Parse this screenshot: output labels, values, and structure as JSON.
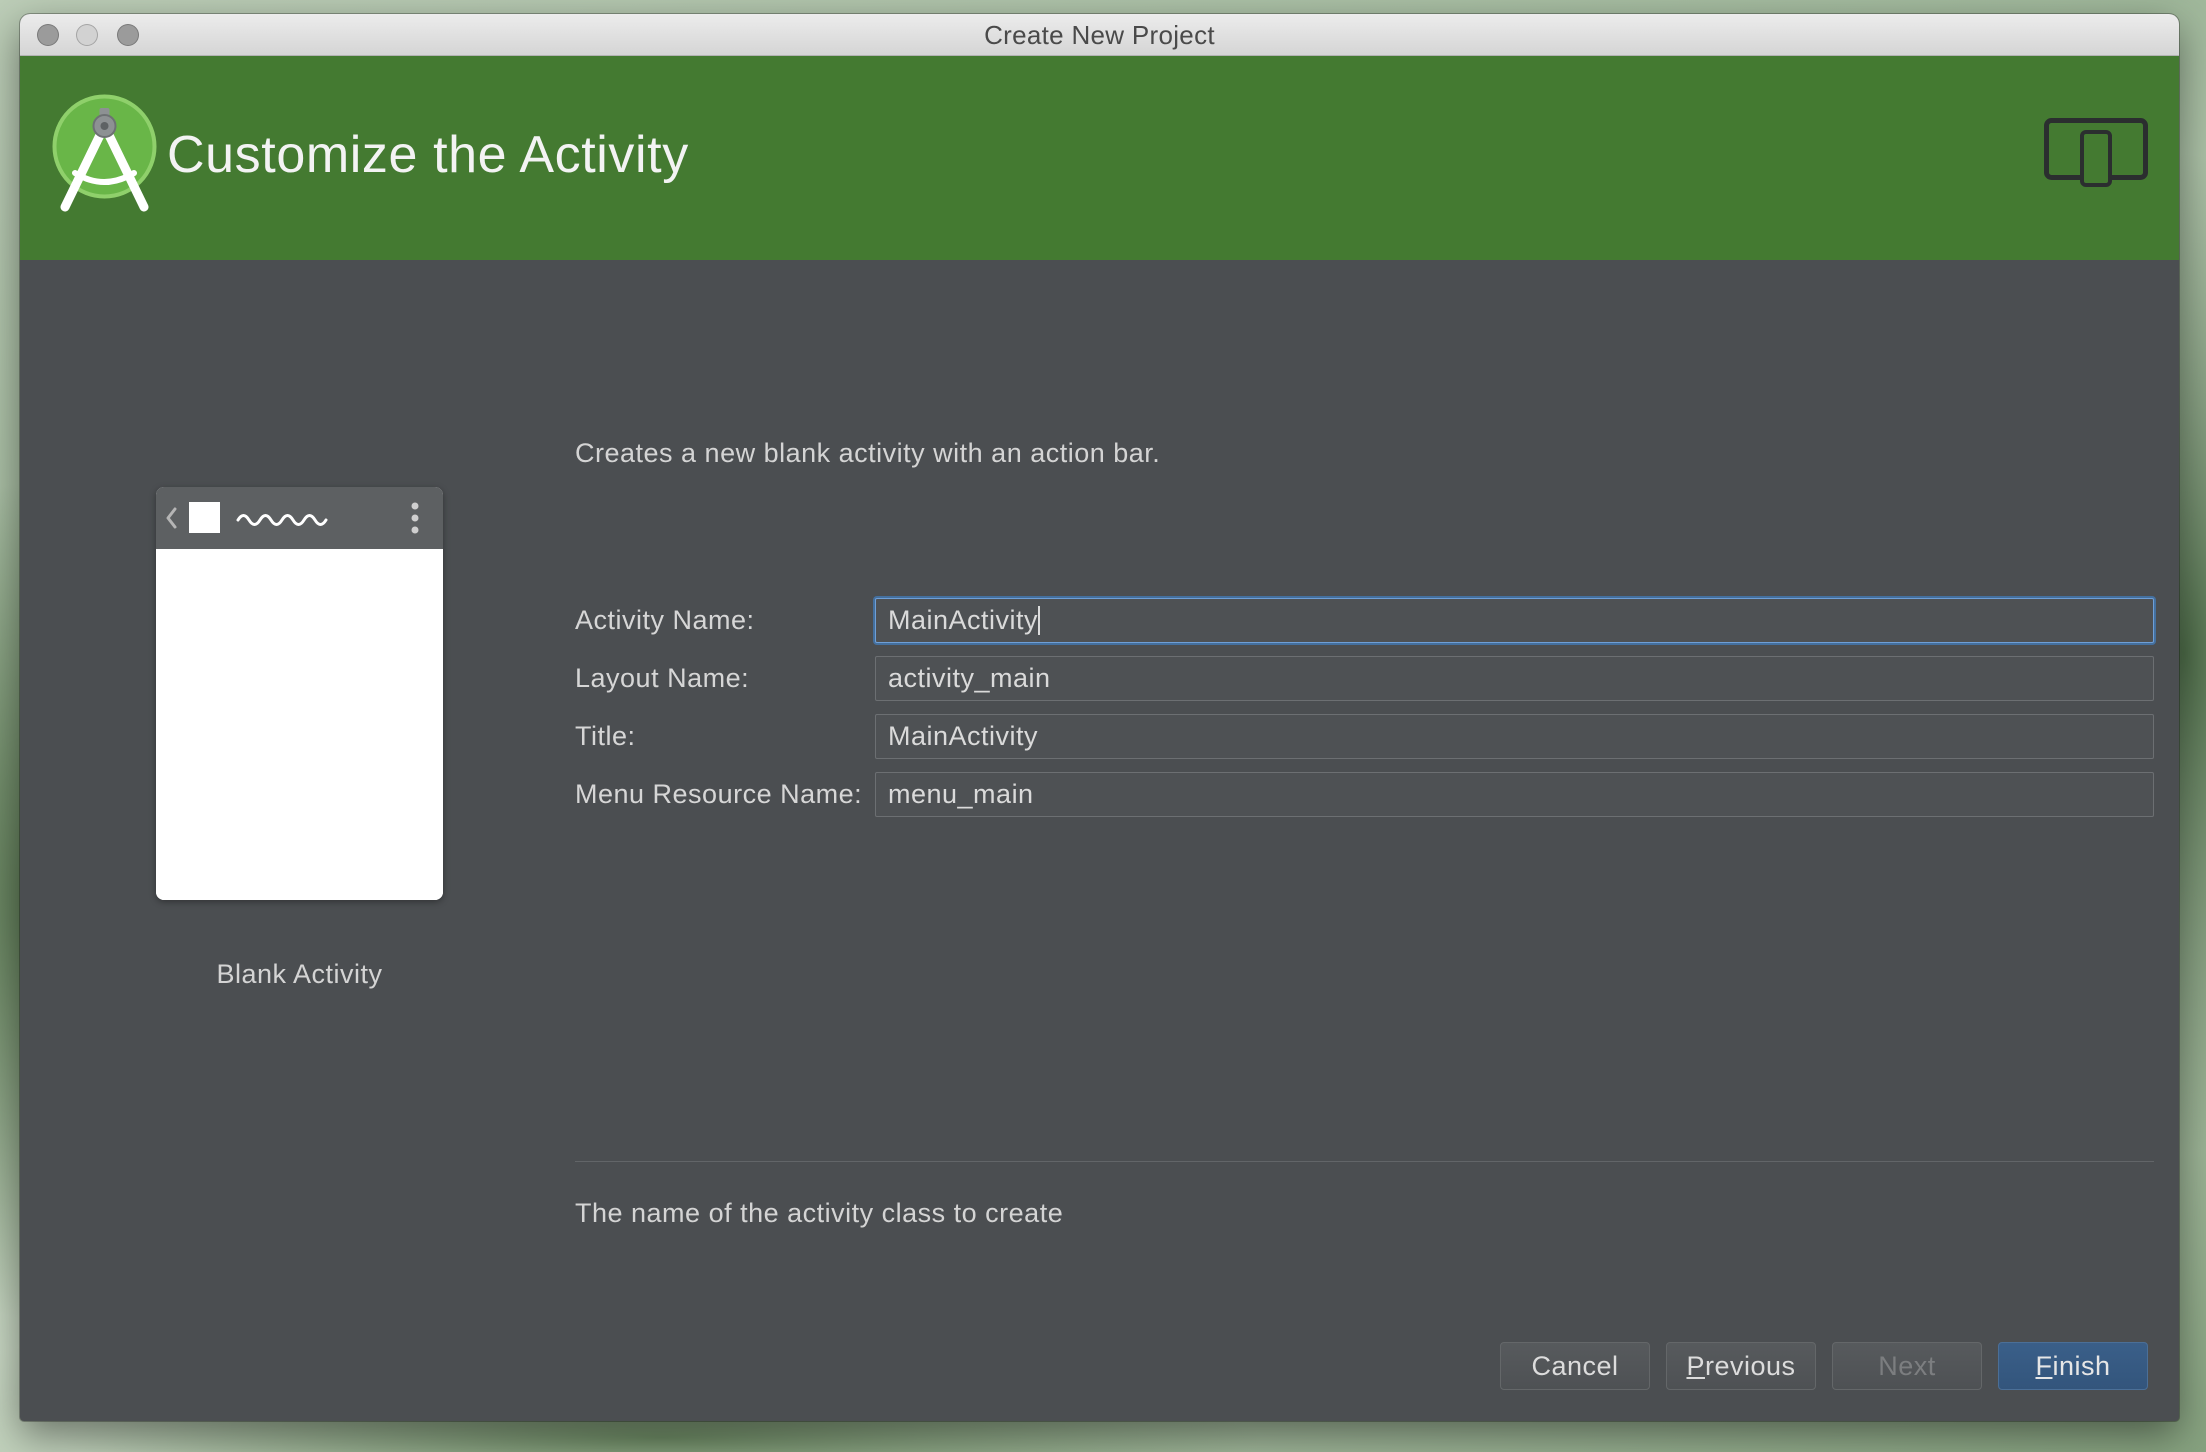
{
  "window": {
    "title": "Create New Project"
  },
  "header": {
    "title": "Customize the Activity",
    "logo_icon": "android-studio-logo-icon",
    "form_factor_icon": "device-form-factor-icon"
  },
  "template": {
    "label": "Blank Activity",
    "toolbar_icons": [
      "back-chevron-icon",
      "app-icon",
      "title-squiggle-icon",
      "overflow-menu-icon"
    ]
  },
  "description": "Creates a new blank activity with an action bar.",
  "form": {
    "fields": [
      {
        "label": "Activity Name:",
        "value": "MainActivity",
        "focused": true
      },
      {
        "label": "Layout Name:",
        "value": "activity_main",
        "focused": false
      },
      {
        "label": "Title:",
        "value": "MainActivity",
        "focused": false
      },
      {
        "label": "Menu Resource Name:",
        "value": "menu_main",
        "focused": false
      }
    ]
  },
  "hint": "The name of the activity class to create",
  "buttons": {
    "cancel": {
      "label": "Cancel",
      "enabled": true,
      "default": false,
      "mnemonic": false
    },
    "previous": {
      "label": "Previous",
      "enabled": true,
      "default": false,
      "mnemonic": true
    },
    "next": {
      "label": "Next",
      "enabled": false,
      "default": false,
      "mnemonic": false
    },
    "finish": {
      "label": "Finish",
      "enabled": true,
      "default": true,
      "mnemonic": true
    }
  },
  "colors": {
    "header": "#447a31",
    "panel": "#4b4e51",
    "default_button": "#365880",
    "focus_ring": "#44709f"
  }
}
